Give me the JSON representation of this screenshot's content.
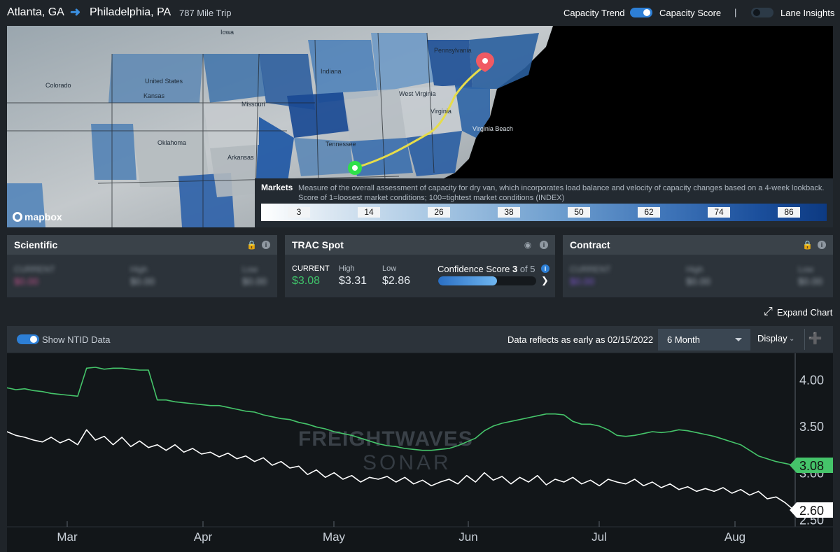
{
  "header": {
    "origin": "Atlanta, GA",
    "destination": "Philadelphia, PA",
    "trip": "787 Mile Trip",
    "capacity_trend_label": "Capacity Trend",
    "capacity_trend_on": true,
    "capacity_score_label": "Capacity Score",
    "separator": "|",
    "lane_insights_label": "Lane Insights",
    "lane_insights_on": false
  },
  "map": {
    "attribution": "mapbox",
    "place_labels": [
      "United States",
      "Tennessee",
      "Arkansas",
      "Pennsylvania",
      "Virginia",
      "Virginia Beach",
      "Indiana",
      "Kansas",
      "Colorado",
      "Oklahoma",
      "West Virginia",
      "Iowa",
      "Missouri"
    ],
    "origin_marker": "green-dot",
    "destination_marker": "red-pin"
  },
  "legend": {
    "title": "Markets",
    "description": "Measure of the overall assessment of capacity for dry van, which incorporates load balance and velocity of capacity changes based on a 4-week lookback. Score of 1=loosest market conditions; 100=tightest market conditions (INDEX)",
    "ticks": [
      "3",
      "14",
      "26",
      "38",
      "50",
      "62",
      "74",
      "86"
    ]
  },
  "cards": {
    "scientific": {
      "title": "Scientific",
      "current_label": "CURRENT",
      "current": "$0.00",
      "high_label": "High",
      "high": "$0.00",
      "low_label": "Low",
      "low": "$0.00"
    },
    "trac_spot": {
      "title": "TRAC Spot",
      "current_label": "CURRENT",
      "current": "$3.08",
      "high_label": "High",
      "high": "$3.31",
      "low_label": "Low",
      "low": "$2.86",
      "confidence_label": "Confidence Score",
      "confidence_score": "3",
      "confidence_of": "of 5",
      "confidence_fraction": 0.6
    },
    "contract": {
      "title": "Contract",
      "current_label": "CURRENT",
      "current": "$0.00",
      "high_label": "High",
      "high": "$0.00",
      "low_label": "Low",
      "low": "$0.00"
    }
  },
  "expand_label": "Expand Chart",
  "chart_controls": {
    "ntid_label": "Show NTID Data",
    "ntid_on": true,
    "reflect_text": "Data reflects as early as 02/15/2022",
    "range_selected": "6 Month",
    "display_label": "Display"
  },
  "colors": {
    "accent": "#2d7fd6",
    "green_series": "#45c46a",
    "white_series": "#ffffff",
    "panel_bg": "#2c333a",
    "chart_bg": "#121619"
  },
  "chart_data": {
    "type": "line",
    "watermark": [
      "FREIGHTWAVES",
      "SONAR"
    ],
    "x_ticks": [
      "Mar",
      "Apr",
      "May",
      "Jun",
      "Jul",
      "Aug"
    ],
    "y_ticks": [
      "4.00",
      "3.50",
      "3.00",
      "2.50"
    ],
    "ylim": [
      2.42,
      4.28
    ],
    "current_labels": [
      "3.08",
      "2.60"
    ],
    "series": [
      {
        "color": "#45c46a",
        "values": [
          3.91,
          3.89,
          3.9,
          3.88,
          3.87,
          3.85,
          3.84,
          3.83,
          3.82,
          4.12,
          4.13,
          4.11,
          4.12,
          4.12,
          4.11,
          4.1,
          4.1,
          3.78,
          3.78,
          3.76,
          3.75,
          3.74,
          3.73,
          3.72,
          3.72,
          3.7,
          3.68,
          3.66,
          3.65,
          3.62,
          3.6,
          3.58,
          3.57,
          3.54,
          3.52,
          3.49,
          3.47,
          3.44,
          3.42,
          3.4,
          3.37,
          3.34,
          3.31,
          3.29,
          3.28,
          3.26,
          3.25,
          3.24,
          3.24,
          3.25,
          3.26,
          3.29,
          3.33,
          3.37,
          3.45,
          3.5,
          3.53,
          3.55,
          3.57,
          3.59,
          3.61,
          3.63,
          3.63,
          3.62,
          3.55,
          3.52,
          3.52,
          3.5,
          3.46,
          3.4,
          3.39,
          3.4,
          3.42,
          3.44,
          3.43,
          3.44,
          3.46,
          3.45,
          3.43,
          3.41,
          3.39,
          3.36,
          3.33,
          3.3,
          3.24,
          3.18,
          3.15,
          3.12,
          3.1,
          3.08
        ]
      },
      {
        "color": "#ffffff",
        "values": [
          3.44,
          3.4,
          3.38,
          3.35,
          3.33,
          3.38,
          3.32,
          3.36,
          3.3,
          3.46,
          3.35,
          3.39,
          3.3,
          3.38,
          3.28,
          3.34,
          3.27,
          3.3,
          3.24,
          3.3,
          3.22,
          3.26,
          3.2,
          3.22,
          3.17,
          3.21,
          3.15,
          3.18,
          3.12,
          3.16,
          3.08,
          3.12,
          3.05,
          3.07,
          2.98,
          3.03,
          2.95,
          3.0,
          2.93,
          2.97,
          2.9,
          2.95,
          2.93,
          2.96,
          2.9,
          2.95,
          2.88,
          2.92,
          2.86,
          2.9,
          2.93,
          2.88,
          2.97,
          2.9,
          3.0,
          2.92,
          2.96,
          2.88,
          2.95,
          2.9,
          2.97,
          2.87,
          2.93,
          2.9,
          2.95,
          2.88,
          2.92,
          2.86,
          2.93,
          2.9,
          2.88,
          2.93,
          2.86,
          2.9,
          2.84,
          2.88,
          2.82,
          2.85,
          2.8,
          2.83,
          2.8,
          2.84,
          2.78,
          2.82,
          2.76,
          2.8,
          2.72,
          2.74,
          2.68,
          2.6
        ]
      }
    ]
  }
}
